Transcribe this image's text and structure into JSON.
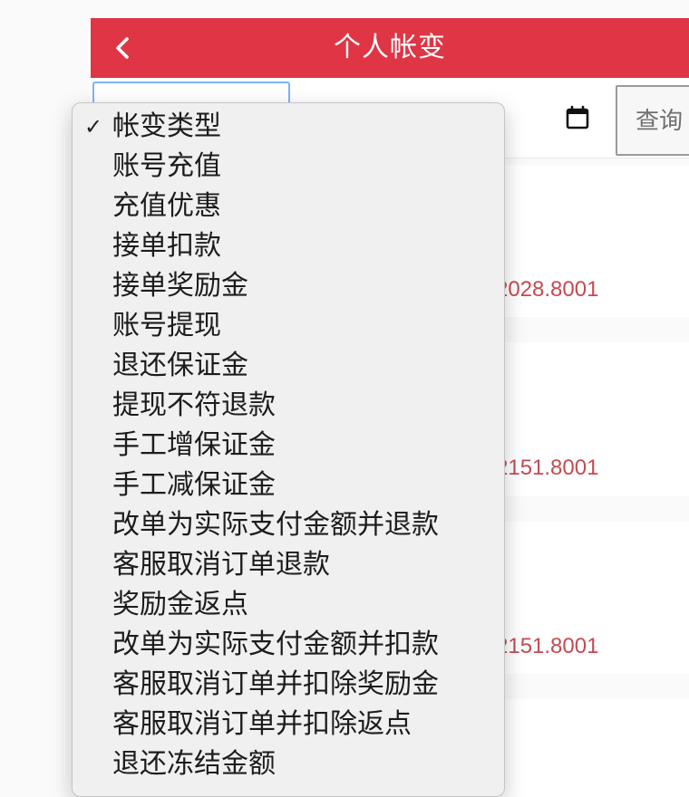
{
  "header": {
    "title": "个人帐变",
    "accent_color": "#df3545",
    "back_icon": "chevron-left-icon"
  },
  "filter": {
    "date_icon": "calendar-icon",
    "query_label": "查询"
  },
  "cards": [
    {
      "amount": "2028.8001"
    },
    {
      "amount": "2151.8001"
    },
    {
      "amount": "2151.8001"
    }
  ],
  "dropdown": {
    "selected": "帐变类型",
    "check_mark": "✓",
    "options": [
      "帐变类型",
      "账号充值",
      "充值优惠",
      "接单扣款",
      "接单奖励金",
      "账号提现",
      "退还保证金",
      "提现不符退款",
      "手工增保证金",
      "手工减保证金",
      "改单为实际支付金额并退款",
      "客服取消订单退款",
      "奖励金返点",
      "改单为实际支付金额并扣款",
      "客服取消订单并扣除奖励金",
      "客服取消订单并扣除返点",
      "退还冻结金额"
    ]
  }
}
